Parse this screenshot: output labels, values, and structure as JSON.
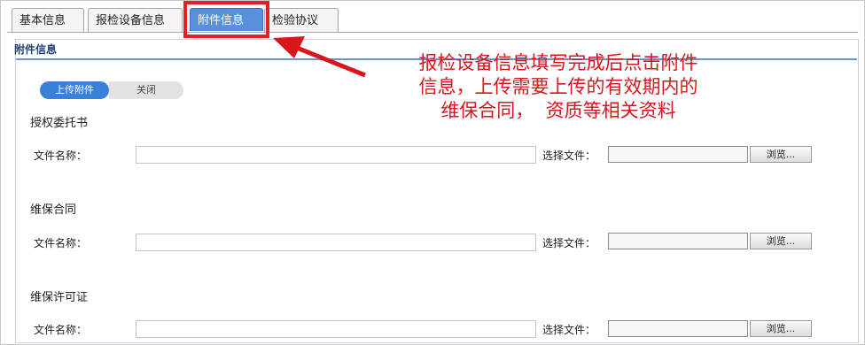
{
  "tabs": [
    {
      "label": "基本信息",
      "active": false
    },
    {
      "label": "报检设备信息",
      "active": false
    },
    {
      "label": "附件信息",
      "active": true
    },
    {
      "label": "检验协议",
      "active": false
    }
  ],
  "panel": {
    "title": "附件信息",
    "upload_label": "上传附件",
    "close_label": "关闭"
  },
  "sections": [
    {
      "title": "授权委托书",
      "name_label": "文件名称：",
      "name_value": "",
      "choose_label": "选择文件：",
      "browse_label": "浏览..."
    },
    {
      "title": "维保合同",
      "name_label": "文件名称：",
      "name_value": "",
      "choose_label": "选择文件：",
      "browse_label": "浏览..."
    },
    {
      "title": "维保许可证",
      "name_label": "文件名称：",
      "name_value": "",
      "choose_label": "选择文件：",
      "browse_label": "浏览..."
    }
  ],
  "annotation": {
    "lines": [
      "报检设备信息填写完成后点击附件",
      "信息，上传需要上传的有效期内的",
      "维保合同，  资质等相关资料"
    ],
    "color": "#d8161d"
  },
  "colors": {
    "accent": "#3a7fd9",
    "highlight": "#e52020"
  }
}
